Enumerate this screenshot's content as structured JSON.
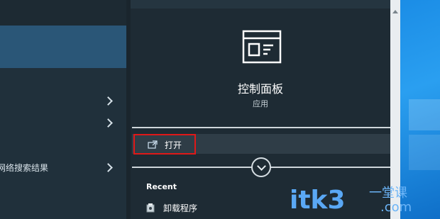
{
  "left_panel": {
    "rows": [
      {
        "label": "",
        "has_arrow": true
      },
      {
        "label": "",
        "has_arrow": true
      },
      {
        "label": "网络搜索结果",
        "has_arrow": true
      }
    ]
  },
  "detail": {
    "icon": "control-panel-icon",
    "title": "控制面板",
    "subtitle": "应用",
    "actions": [
      {
        "label": "打开",
        "icon": "open-external-icon"
      }
    ],
    "expand_icon": "chevron-down-icon",
    "recent_header": "Recent",
    "recent_items": [
      {
        "label": "卸载程序",
        "icon": "uninstall-program-icon"
      }
    ]
  },
  "watermark": {
    "main": "itk3",
    "top": "一堂课",
    "bottom": ".com"
  },
  "colors": {
    "highlight_border": "#e01818",
    "selected_row": "#2a5677",
    "accent_blue": "#5aa8f5"
  }
}
